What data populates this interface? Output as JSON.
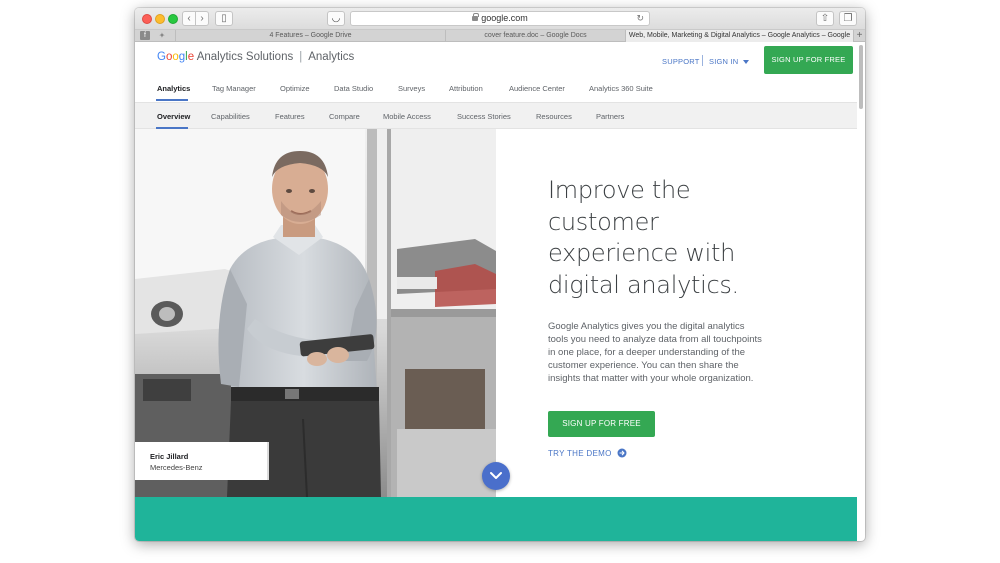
{
  "browser": {
    "url": "google.com",
    "tabs": [
      {
        "label": "4 Features – Google Drive"
      },
      {
        "label": "cover feature.doc – Google Docs"
      },
      {
        "label": "Web, Mobile, Marketing & Digital Analytics – Google Analytics – Google"
      }
    ],
    "new_tab_label": "+"
  },
  "header": {
    "logo_letters": [
      "G",
      "o",
      "o",
      "g",
      "l",
      "e"
    ],
    "logo_product": "Analytics Solutions",
    "logo_section": "Analytics",
    "support_label": "SUPPORT",
    "signin_label": "SIGN IN",
    "signup_label": "SIGN UP FOR FREE"
  },
  "primary_nav": {
    "items": [
      {
        "label": "Analytics"
      },
      {
        "label": "Tag Manager"
      },
      {
        "label": "Optimize"
      },
      {
        "label": "Data Studio"
      },
      {
        "label": "Surveys"
      },
      {
        "label": "Attribution"
      },
      {
        "label": "Audience Center"
      },
      {
        "label": "Analytics 360 Suite"
      }
    ],
    "active_index": 0
  },
  "secondary_nav": {
    "items": [
      {
        "label": "Overview"
      },
      {
        "label": "Capabilities"
      },
      {
        "label": "Features"
      },
      {
        "label": "Compare"
      },
      {
        "label": "Mobile Access"
      },
      {
        "label": "Success Stories"
      },
      {
        "label": "Resources"
      },
      {
        "label": "Partners"
      }
    ],
    "active_index": 0
  },
  "hero": {
    "title_lines": [
      "Improve the",
      "customer",
      "experience with",
      "digital analytics."
    ],
    "body": "Google Analytics gives you the digital analytics tools you need to analyze data from all touchpoints in one place, for a deeper understanding of the customer experience. You can then share the insights that matter with your whole organization.",
    "cta_label": "SIGN UP FOR FREE",
    "demo_label": "TRY THE DEMO",
    "caption_name": "Eric Jillard",
    "caption_company": "Mercedes-Benz"
  },
  "colors": {
    "accent_blue": "#4a76c6",
    "cta_green": "#34a853",
    "teal_band": "#1fb49a",
    "scroll_button": "#4a6fcb"
  },
  "icons": {
    "scroll": "chevron-down-icon",
    "demo": "arrow-right-circle-icon",
    "signin": "caret-down-icon",
    "lock": "lock-icon"
  }
}
